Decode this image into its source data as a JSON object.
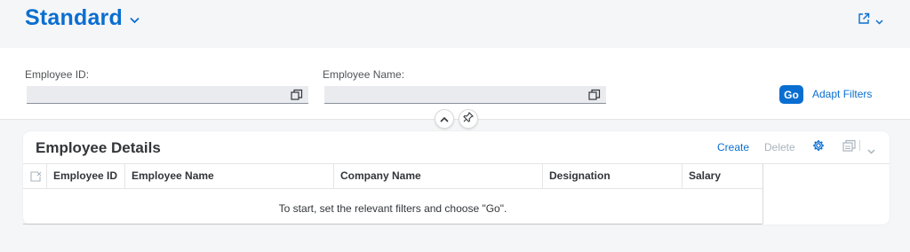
{
  "header": {
    "variant_title": "Standard"
  },
  "filters": {
    "employee_id": {
      "label": "Employee ID:",
      "value": ""
    },
    "employee_name": {
      "label": "Employee Name:",
      "value": ""
    },
    "go_label": "Go",
    "adapt_label": "Adapt Filters"
  },
  "table": {
    "title": "Employee Details",
    "create_label": "Create",
    "delete_label": "Delete",
    "columns": [
      "Employee ID",
      "Employee Name",
      "Company Name",
      "Designation",
      "Salary"
    ],
    "empty_text": "To start, set the relevant filters and choose \"Go\"."
  },
  "colors": {
    "brand": "#0a6ed1",
    "disabled": "#a9b4be"
  },
  "icons": [
    "chevron-down-icon",
    "share-icon",
    "value-help-icon",
    "collapse-icon",
    "pin-icon",
    "settings-icon",
    "export-icon",
    "select-all-icon"
  ]
}
